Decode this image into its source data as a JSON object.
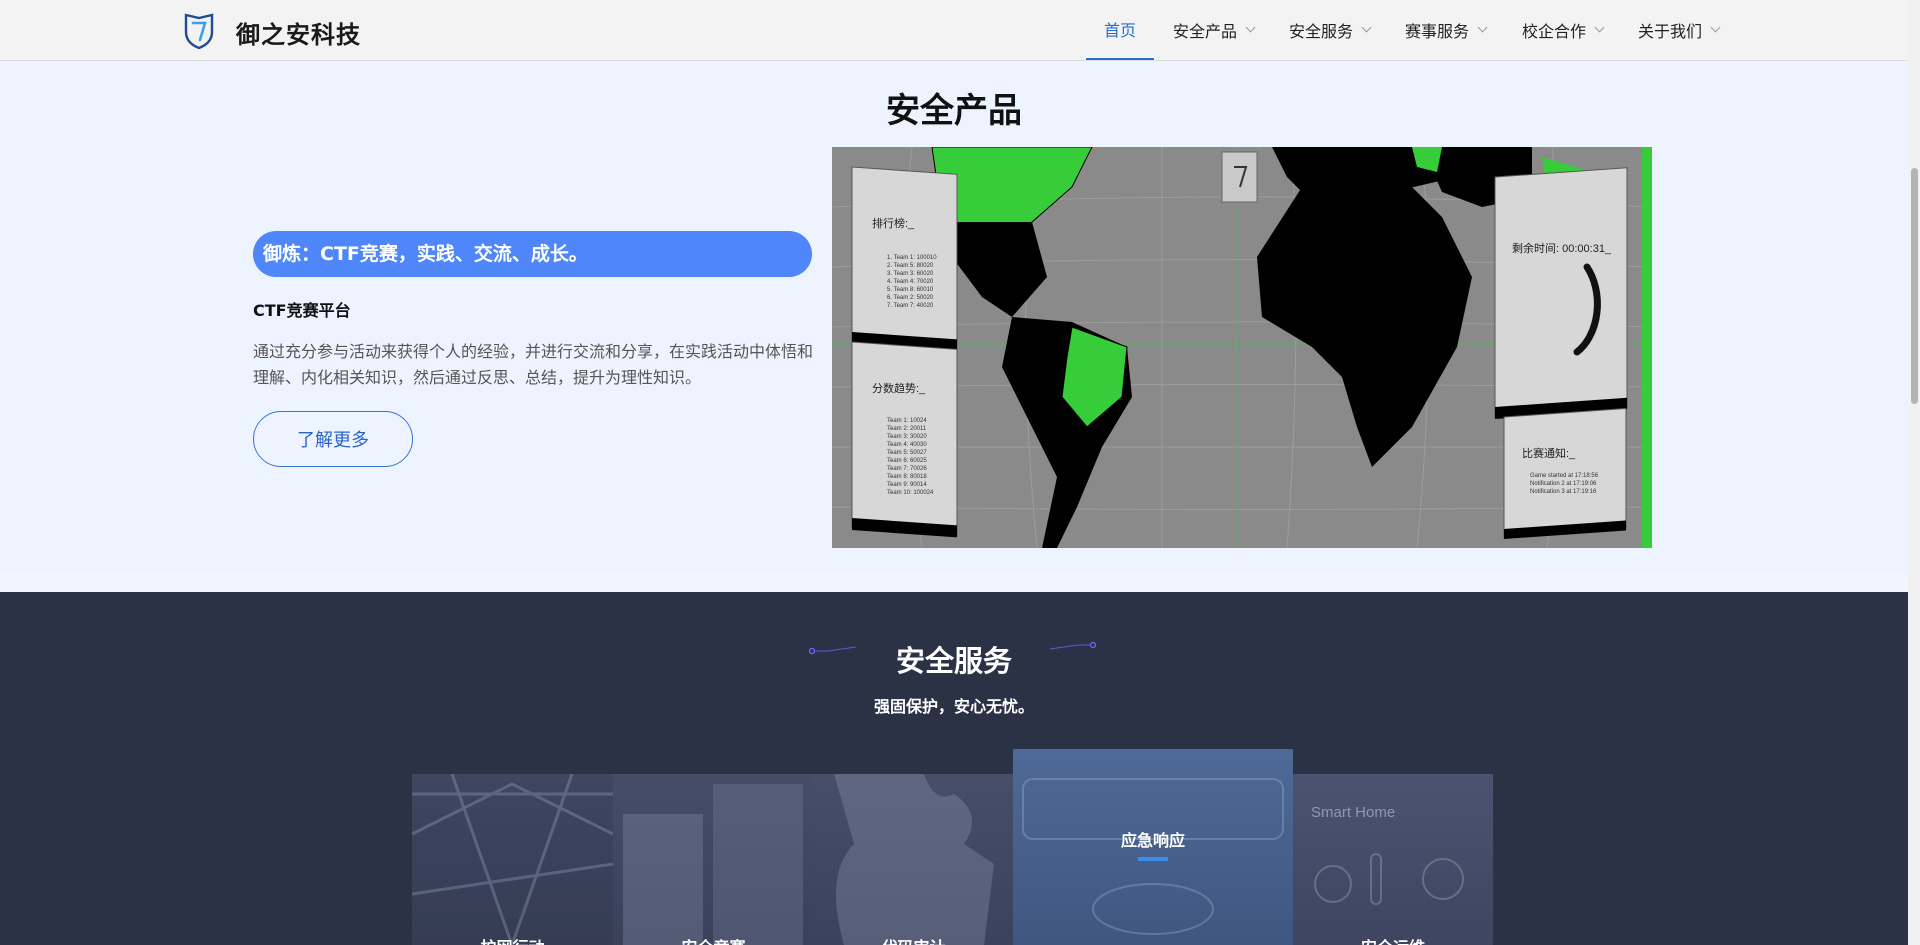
{
  "header": {
    "brand": "御之安科技",
    "nav": [
      {
        "label": "首页",
        "active": true
      },
      {
        "label": "安全产品"
      },
      {
        "label": "安全服务"
      },
      {
        "label": "赛事服务"
      },
      {
        "label": "校企合作"
      },
      {
        "label": "关于我们"
      }
    ]
  },
  "products": {
    "title": "安全产品",
    "banner": "御炼：CTF竞赛，实践、交流、成长。",
    "name": "CTF竞赛平台",
    "description": "通过充分参与活动来获得个人的经验，并进行交流和分享，在实践活动中体悟和理解、内化相关知识，然后通过反思、总结，提升为理性知识。",
    "more_button": "了解更多",
    "screenshot": {
      "leaderboard_title": "排行榜:_",
      "leaderboard": [
        "1. Team 1: 100010",
        "2. Team 5: 80020",
        "3. Team 3: 60020",
        "4. Team 4: 70020",
        "5. Team 8: 60010",
        "6. Team 2: 50020",
        "7. Team 7: 40020"
      ],
      "trend_title": "分数趋势:_",
      "trend": [
        "Team 1: 10024",
        "Team 2: 20011",
        "Team 3: 30020",
        "Team 4: 40030",
        "Team 5: 50027",
        "Team 6: 60025",
        "Team 7: 70026",
        "Team 8: 80018",
        "Team 9: 90014",
        "Team 10: 100024"
      ],
      "timer": "剩余时间: 00:00:31_",
      "notice_title": "比赛通知:_",
      "notices": [
        "Game started at 17:18:56",
        "Notification 2 at 17:19:06",
        "Notification 3 at 17:19:16"
      ]
    }
  },
  "services": {
    "title": "安全服务",
    "subtitle": "强固保护，安心无忧。",
    "cards": [
      {
        "label": "护网行动"
      },
      {
        "label": "安全竞赛"
      },
      {
        "label": "代码审计"
      },
      {
        "label": "应急响应",
        "active": true
      },
      {
        "label": "安全运维",
        "image_text": "Smart Home"
      }
    ]
  },
  "colors": {
    "accent": "#4f86fa",
    "nav_active": "#2a6ad6",
    "dark_section": "#2c3246",
    "map_highlight": "#37cc3a"
  }
}
